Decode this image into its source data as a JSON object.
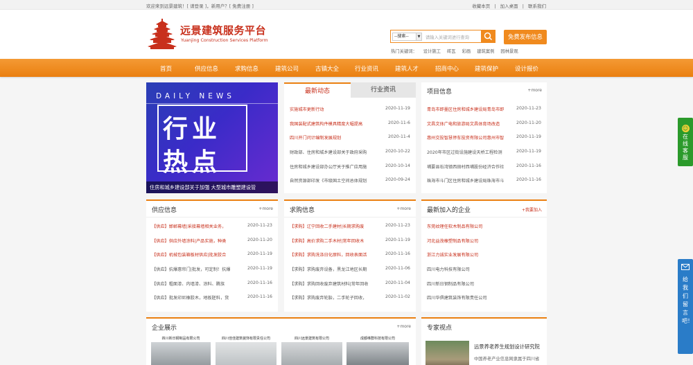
{
  "topbar": {
    "welcome": "欢迎来到远景建筑！[ 请登录 ]，新用户？[ 免费注册 ]",
    "links": [
      "收藏本页",
      "|",
      "加入桌面",
      "|",
      "联系我们"
    ]
  },
  "brand": {
    "title": "远景建筑服务平台",
    "subtitle": "Yuanjing Construction Services Platform"
  },
  "search": {
    "select_value": "--搜索--",
    "placeholder": "请输入关键词进行查询",
    "hot_label": "热门关键词：",
    "hot_words": [
      "设计施工",
      "砖瓦",
      "彩画",
      "建筑案例",
      "园林景观"
    ],
    "publish_label": "免费发布信息"
  },
  "nav": [
    "首页",
    "供应信息",
    "求购信息",
    "建筑公司",
    "古镇大全",
    "行业资讯",
    "建筑人才",
    "招商中心",
    "建筑保护",
    "设计报价"
  ],
  "banner": {
    "daily_news": "DAILY NEWS",
    "big_line1": "行业",
    "big_line2": "热点",
    "caption": "住房和城乡建设部关于加强 大型城市雕塑建设管"
  },
  "news_tabs": {
    "active": "最新动态",
    "inactive": "行业资讯",
    "items": [
      {
        "title": "实施城市更新行动",
        "date": "2020-11-19",
        "hl": true
      },
      {
        "title": "我国装配式建筑构件模具精度大幅提高",
        "date": "2020-11-6",
        "hl": true
      },
      {
        "title": "四川开门问计编制发展规划",
        "date": "2020-11-4",
        "hl": true
      },
      {
        "title": "财政部、住房和城乡建设部关于政府采购",
        "date": "2020-10-22",
        "hl": false
      },
      {
        "title": "住房和城乡建设部办公厅关于推广应用施",
        "date": "2020-10-14",
        "hl": false
      },
      {
        "title": "自然资源部印发《市级国土空间总体规划",
        "date": "2020-09-24",
        "hl": false
      }
    ]
  },
  "projects": {
    "title": "项目信息",
    "more": "+more",
    "items": [
      {
        "title": "青岛市即墨区住房和城乡建设局青岛市即",
        "date": "2020-11-23",
        "hl": true
      },
      {
        "title": "文昌文体广电和旅游局文昌体育场改造",
        "date": "2020-11-20",
        "hl": true
      },
      {
        "title": "惠州交投智慧停车投资有限公司惠州市智",
        "date": "2020-11-19",
        "hl": true
      },
      {
        "title": "2020年市区过街设施建设天桥工程检测",
        "date": "2020-11-19",
        "hl": false
      },
      {
        "title": "埔要县石湾镇西田村西埔股份经济合作社",
        "date": "2020-11-16",
        "hl": false
      },
      {
        "title": "珠海市斗门区住房和城乡建设局珠海市斗",
        "date": "2020-11-16",
        "hl": false
      }
    ]
  },
  "supply": {
    "title": "供应信息",
    "more": "+more",
    "items": [
      {
        "title": "【供应】邯郸幕墙|采接幕墙相关业务，",
        "date": "2020-11-23",
        "hl": true
      },
      {
        "title": "【供应】供应外墙涂料|产品实施，种类",
        "date": "2020-11-20",
        "hl": true
      },
      {
        "title": "【供应】机械包装箱板材供应|批发胶合",
        "date": "2020-11-19",
        "hl": true
      },
      {
        "title": "【供应】抗爆惠帘门|批发，可定制！抗爆",
        "date": "2020-11-19",
        "hl": false
      },
      {
        "title": "【供应】粗面漆、内墙漆、涂料、腾族",
        "date": "2020-11-16",
        "hl": false
      },
      {
        "title": "【供应】批发印尼橡胶木，地板胚料，货",
        "date": "2020-11-16",
        "hl": false
      }
    ]
  },
  "purchase": {
    "title": "求购信息",
    "more": "+more",
    "items": [
      {
        "title": "【求购】辽宁回收二手建材|长期求购废",
        "date": "2020-11-23",
        "hl": true
      },
      {
        "title": "【求购】高价求购二手木材|常年回收木",
        "date": "2020-11-19",
        "hl": true
      },
      {
        "title": "【求购】求购洗涤日化原料，回收表面活",
        "date": "2020-11-16",
        "hl": true
      },
      {
        "title": "【求购】求购废弃设备，黑龙江地区长期",
        "date": "2020-11-06",
        "hl": false
      },
      {
        "title": "【求购】求购回收废弃建筑材料|常年回收",
        "date": "2020-11-04",
        "hl": false
      },
      {
        "title": "【求购】求购废弃轮胎，二手轮子回收，",
        "date": "2020-11-02",
        "hl": false
      }
    ]
  },
  "companies": {
    "title": "最新加入的企业",
    "more": "+我要加入",
    "items": [
      {
        "name": "东莞纹理任软木制品有限公司",
        "hl": true
      },
      {
        "name": "河北益茂橡塑制品有限公司",
        "hl": true
      },
      {
        "name": "浙江力诚实业发展有限公司",
        "hl": true
      },
      {
        "name": "四川电力科技有限公司",
        "hl": false
      },
      {
        "name": "四川新日钢制品有限公司",
        "hl": false
      },
      {
        "name": "四川华俱建筑装饰有限责任公司",
        "hl": false
      }
    ]
  },
  "showcase": {
    "title": "企业展示",
    "more": "+more",
    "items": [
      "四川新日钢制品有限公司",
      "四川佳佳建筑装饰有限责任公司",
      "四川远景建筑有限公司",
      "成都维群科技有限公司"
    ]
  },
  "experts": {
    "title": "专家视点",
    "text_line1": "远景养老养生规划设计研究院",
    "text_line2": "中国养老产业信息网隶属于四川省"
  },
  "side_service": "在线客服",
  "side_message": "给我们留言吧！",
  "colors": {
    "accent": "#ea7f10",
    "brand_red": "#c8301c"
  }
}
